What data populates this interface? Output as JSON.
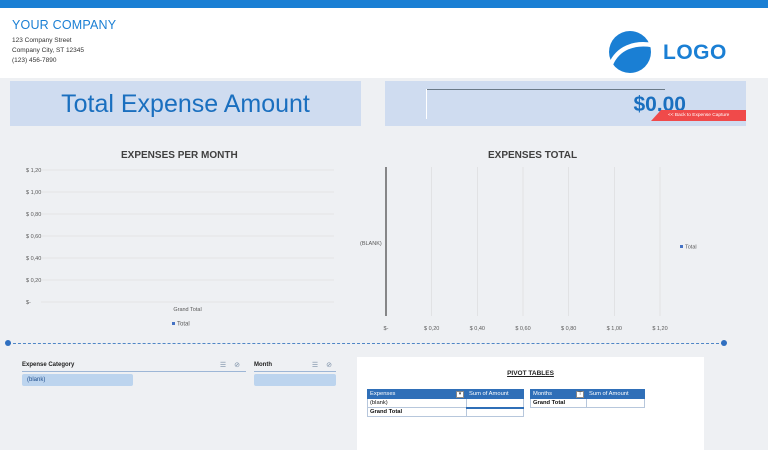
{
  "header": {
    "company_name": "YOUR COMPANY",
    "address_lines": [
      "123 Company Street",
      "Company City, ST 12345",
      "(123) 456-7890"
    ],
    "logo_text": "LOGO",
    "brand_color": "#1a7fd4"
  },
  "banner": {
    "title": "Total Expense Amount",
    "amount": "$0,00",
    "back_button_label": "<< Back to Expense Capture",
    "back_button_color": "#f04a4a"
  },
  "chart_data": [
    {
      "type": "bar",
      "title": "EXPENSES PER MONTH",
      "categories": [
        "Grand Total"
      ],
      "series": [
        {
          "name": "Total",
          "values": [
            0
          ]
        }
      ],
      "y_tick_labels": [
        "$ 1,20",
        "$ 1,00",
        "$ 0,80",
        "$ 0,60",
        "$ 0,40",
        "$ 0,20",
        "$-"
      ],
      "ylim": [
        0,
        1.2
      ],
      "grid": true,
      "legend": "bottom",
      "series_color": "#4472c4"
    },
    {
      "type": "bar",
      "orientation": "horizontal",
      "title": "EXPENSES TOTAL",
      "categories": [
        "(BLANK)"
      ],
      "series": [
        {
          "name": "Total",
          "values": [
            0
          ]
        }
      ],
      "x_tick_labels": [
        "$-",
        "$ 0,20",
        "$ 0,40",
        "$ 0,60",
        "$ 0,80",
        "$ 1,00",
        "$ 1,20"
      ],
      "xlim": [
        0,
        1.2
      ],
      "grid": true,
      "legend": "right",
      "series_color": "#4472c4"
    }
  ],
  "slicers": [
    {
      "title": "Expense Category",
      "items": [
        "(blank)"
      ]
    },
    {
      "title": "Month",
      "items": [
        ""
      ]
    }
  ],
  "pivot": {
    "heading": "PIVOT TABLES",
    "table1": {
      "col1": "Expenses",
      "col2": "Sum of Amount",
      "row1": "(blank)",
      "row2": "Grand Total"
    },
    "table2": {
      "col1": "Months",
      "col2": "Sum of Amount",
      "row1": "Grand Total"
    }
  }
}
